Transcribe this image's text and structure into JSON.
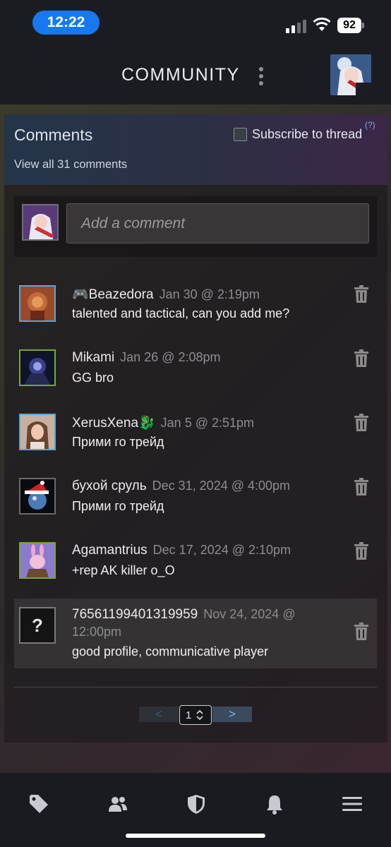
{
  "status_bar": {
    "time": "12:22",
    "battery": "92"
  },
  "header": {
    "title": "COMMUNITY"
  },
  "comments_panel": {
    "title": "Comments",
    "subscribe_label": "Subscribe to thread",
    "help_mark": "(?)",
    "view_all": "View all 31 comments",
    "add_placeholder": "Add a comment"
  },
  "comments": [
    {
      "author": "🎮Beazedora",
      "time": "Jan 30 @ 2:19pm",
      "text": "talented and tactical, can you add me?"
    },
    {
      "author": "Mikami",
      "time": "Jan 26 @ 2:08pm",
      "text": "GG bro"
    },
    {
      "author": "XerusXena🐉",
      "time": "Jan 5 @ 2:51pm",
      "text": "Прими го трейд"
    },
    {
      "author": "бухой сруль",
      "time": "Dec 31, 2024 @ 4:00pm",
      "text": "Прими го трейд"
    },
    {
      "author": "Agamantrius",
      "time": "Dec 17, 2024 @ 2:10pm",
      "text": "+rep AK killer o_O"
    },
    {
      "author": "76561199401319959",
      "time": "Nov 24, 2024 @",
      "time2": "12:00pm",
      "text": "good profile, communicative player"
    }
  ],
  "pager": {
    "prev": "<",
    "page": "1",
    "next": ">"
  },
  "unknown_avatar_mark": "?"
}
